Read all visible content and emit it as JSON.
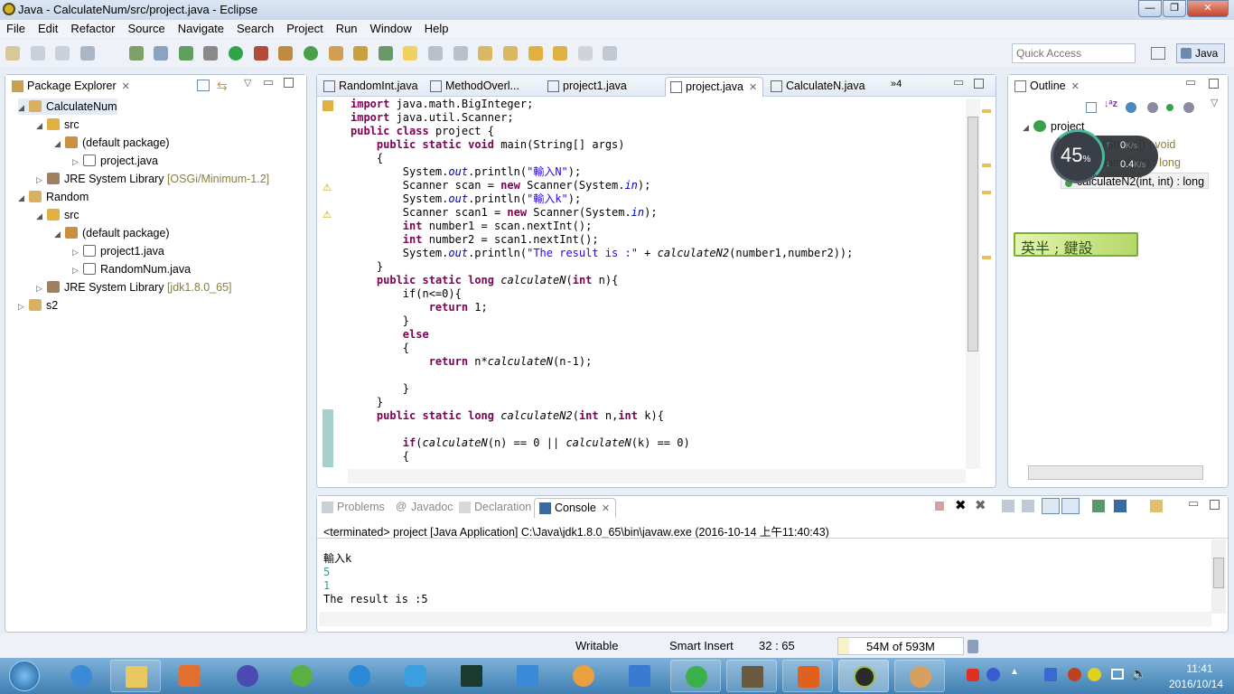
{
  "window": {
    "title": "Java - CalculateNum/src/project.java - Eclipse",
    "min": "—",
    "max": "❐",
    "close": "✕"
  },
  "menu": [
    "File",
    "Edit",
    "Refactor",
    "Source",
    "Navigate",
    "Search",
    "Project",
    "Run",
    "Window",
    "Help"
  ],
  "quick_access": {
    "placeholder": "Quick Access"
  },
  "perspective": "Java",
  "package_explorer": {
    "title": "Package Explorer",
    "items": [
      {
        "label": "CalculateNum"
      },
      {
        "label": "src"
      },
      {
        "label": "(default package)"
      },
      {
        "label": "project.java"
      },
      {
        "label": "JRE System Library",
        "suffix": "[OSGi/Minimum-1.2]"
      },
      {
        "label": "Random"
      },
      {
        "label": "src"
      },
      {
        "label": "(default package)"
      },
      {
        "label": "project1.java"
      },
      {
        "label": "RandomNum.java"
      },
      {
        "label": "JRE System Library",
        "suffix": "[jdk1.8.0_65]"
      },
      {
        "label": "s2"
      }
    ]
  },
  "editor": {
    "tabs": [
      "RandomInt.java",
      "MethodOverl...",
      "project1.java",
      "project.java",
      "CalculateN.java"
    ],
    "active_tab": "project.java",
    "overflow": "»4",
    "code": [
      "import java.math.BigInteger;",
      "import java.util.Scanner;",
      "public class project {",
      "    public static void main(String[] args)",
      "    {",
      "        System.out.println(\"輸入N\");",
      "        Scanner scan = new Scanner(System.in);",
      "        System.out.println(\"輸入k\");",
      "        Scanner scan1 = new Scanner(System.in);",
      "        int number1 = scan.nextInt();",
      "        int number2 = scan1.nextInt();",
      "        System.out.println(\"The result is :\" + calculateN2(number1,number2));",
      "    }",
      "    public static long calculateN(int n){",
      "        if(n<=0){",
      "            return 1;",
      "        }",
      "        else",
      "        {",
      "            return n*calculateN(n-1);",
      "",
      "        }",
      "    }",
      "    public static long calculateN2(int n,int k){",
      "",
      "        if(calculateN(n) == 0 || calculateN(k) == 0)",
      "        {"
    ]
  },
  "outline": {
    "title": "Outline",
    "root": "project",
    "items": [
      "main(String[]) : void",
      "calculateN(int) : long",
      "calculateN2(int, int) : long"
    ]
  },
  "net_widget": {
    "percent": "45",
    "percent_sign": "%",
    "upload": "0",
    "download": "0.4",
    "unit": "K/s",
    "percent_value": 45
  },
  "ime_bar": "英半 ; 鍵設",
  "bottom_panel": {
    "tabs": [
      "Problems",
      "Javadoc",
      "Declaration",
      "Console"
    ],
    "active_tab": "Console",
    "console_header": "<terminated> project [Java Application] C:\\Java\\jdk1.8.0_65\\bin\\javaw.exe (2016-10-14 上午11:40:43)",
    "console_lines": [
      "輸入k",
      "5",
      "1",
      "The result is :5"
    ]
  },
  "status": {
    "writable": "Writable",
    "insert_mode": "Smart Insert",
    "position": "32 : 65",
    "heap": "54M of 593M"
  },
  "taskbar": {
    "time": "11:41",
    "date": "2016/10/14"
  }
}
